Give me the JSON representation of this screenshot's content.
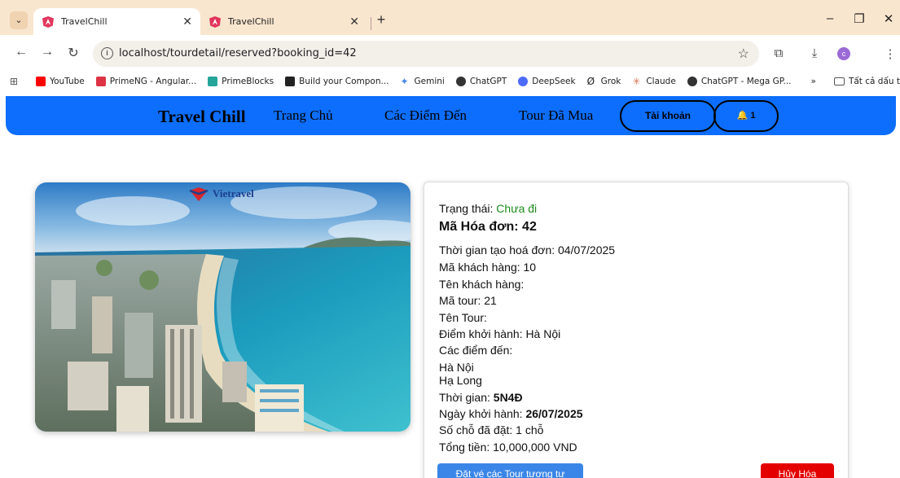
{
  "browser": {
    "tabs": [
      {
        "title": "TravelChill",
        "active": true
      },
      {
        "title": "TravelChill",
        "active": false
      }
    ],
    "url": "localhost/tourdetail/reserved?booking_id=42",
    "profile_letter": "c",
    "bookmarks": [
      {
        "label": "YouTube",
        "color": "#ff0000"
      },
      {
        "label": "PrimeNG - Angular...",
        "color": "#dd3344"
      },
      {
        "label": "PrimeBlocks",
        "color": "#26a69a"
      },
      {
        "label": "Build your Compon...",
        "color": "#222222"
      },
      {
        "label": "Gemini",
        "color": "#4a86e8"
      },
      {
        "label": "ChatGPT",
        "color": "#333333"
      },
      {
        "label": "DeepSeek",
        "color": "#4d6bfe"
      },
      {
        "label": "Grok",
        "color": "#222222"
      },
      {
        "label": "Claude",
        "color": "#d97757"
      },
      {
        "label": "ChatGPT - Mega GP...",
        "color": "#333333"
      }
    ],
    "bookmarks_overflow": "»",
    "all_bookmarks": "Tất cả dấu trang"
  },
  "site": {
    "brand": "Travel Chill",
    "nav": [
      "Trang Chủ",
      "Các Điểm Đến",
      "Tour Đã Mua"
    ],
    "account_button": "Tài khoản",
    "notification_button": "🔔 1",
    "brand_color": "#0d6efd"
  },
  "image": {
    "logo_text": "Vietravel"
  },
  "booking": {
    "status_label": "Trạng thái: ",
    "status_value": "Chưa đi",
    "invoice_title": "Mã Hóa đơn: 42",
    "created": "Thời gian tạo hoá đơn: 04/07/2025",
    "customer_id": "Mã khách hàng: 10",
    "customer_name": "Tên khách hàng:",
    "tour_id": "Mã tour: 21",
    "tour_name": "Tên Tour:",
    "departure_point": "Điểm khởi hành: Hà Nội",
    "destinations_label": "Các điểm đến:",
    "destinations": [
      "Hà Nội",
      "Hạ Long"
    ],
    "duration_label": "Thời gian: ",
    "duration_value": "5N4Đ",
    "departure_date_label": "Ngày khởi hành: ",
    "departure_date_value": "26/07/2025",
    "seats": "Số chỗ đã đặt: 1 chỗ",
    "total": "Tổng tiền: 10,000,000 VND",
    "book_similar_button": "Đặt vé các Tour tương tự khác",
    "cancel_button": "Hủy Hóa đơn"
  }
}
